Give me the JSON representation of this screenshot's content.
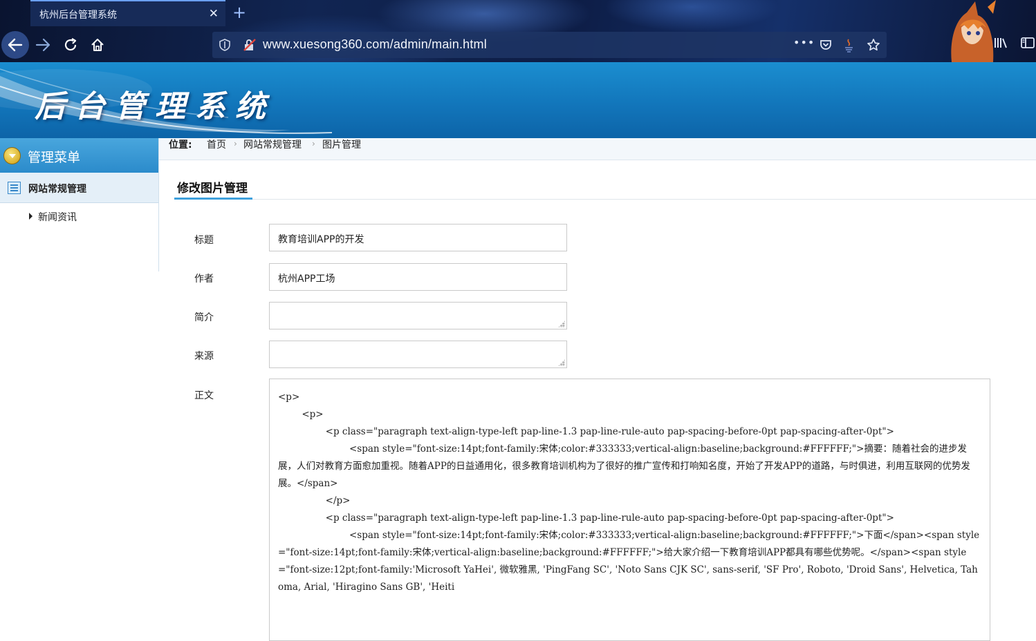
{
  "browser": {
    "tab_title": "杭州后台管理系统",
    "close_glyph": "✕",
    "new_tab_glyph": "+",
    "url": "www.xuesong360.com/admin/main.html",
    "page_actions_glyph": "•••",
    "icons": [
      "back-arrow-icon",
      "forward-arrow-icon",
      "reload-icon",
      "home-icon",
      "shield-icon",
      "insecure-lock-icon",
      "pocket-icon",
      "java-icon",
      "star-icon",
      "library-icon",
      "sidebar-icon"
    ]
  },
  "header": {
    "logo_text": "后台管理系统"
  },
  "sidebar": {
    "heading": "管理菜单",
    "group_label": "网站常规管理",
    "items": [
      {
        "label": "新闻资讯"
      }
    ]
  },
  "breadcrumb": {
    "label": "位置:",
    "items": [
      "首页",
      "网站常规管理",
      "图片管理"
    ],
    "separator": "›"
  },
  "form": {
    "title": "修改图片管理",
    "fields": {
      "title": {
        "label": "标题",
        "value": "教育培训APP的开发"
      },
      "author": {
        "label": "作者",
        "value": "杭州APP工场"
      },
      "summary": {
        "label": "简介",
        "value": ""
      },
      "source": {
        "label": "来源",
        "value": ""
      },
      "body": {
        "label": "正文",
        "value": "<p>\n        <p>\n                <p class=\"paragraph text-align-type-left pap-line-1.3 pap-line-rule-auto pap-spacing-before-0pt pap-spacing-after-0pt\">\n                        <span style=\"font-size:14pt;font-family:宋体;color:#333333;vertical-align:baseline;background:#FFFFFF;\">摘要：随着社会的进步发展，人们对教育方面愈加重视。随着APP的日益通用化，很多教育培训机构为了很好的推广宣传和打响知名度，开始了开发APP的道路，与时俱进，利用互联网的优势发展。</span>\n                </p>\n                <p class=\"paragraph text-align-type-left pap-line-1.3 pap-line-rule-auto pap-spacing-before-0pt pap-spacing-after-0pt\">\n                        <span style=\"font-size:14pt;font-family:宋体;color:#333333;vertical-align:baseline;background:#FFFFFF;\">下面</span><span style=\"font-size:14pt;font-family:宋体;vertical-align:baseline;background:#FFFFFF;\">给大家介绍一下教育培训APP都具有哪些优势呢。</span><span style=\"font-size:12pt;font-family:'Microsoft YaHei', 微软雅黑, 'PingFang SC', 'Noto Sans CJK SC', sans-serif, 'SF Pro', Roboto, 'Droid Sans', Helvetica, Tahoma, Arial, 'Hiragino Sans GB', 'Heiti"
      }
    }
  },
  "colors": {
    "header_blue": "#1276bb",
    "menu_blue": "#2b8bcb",
    "accent_underline": "#3ea0dc"
  }
}
